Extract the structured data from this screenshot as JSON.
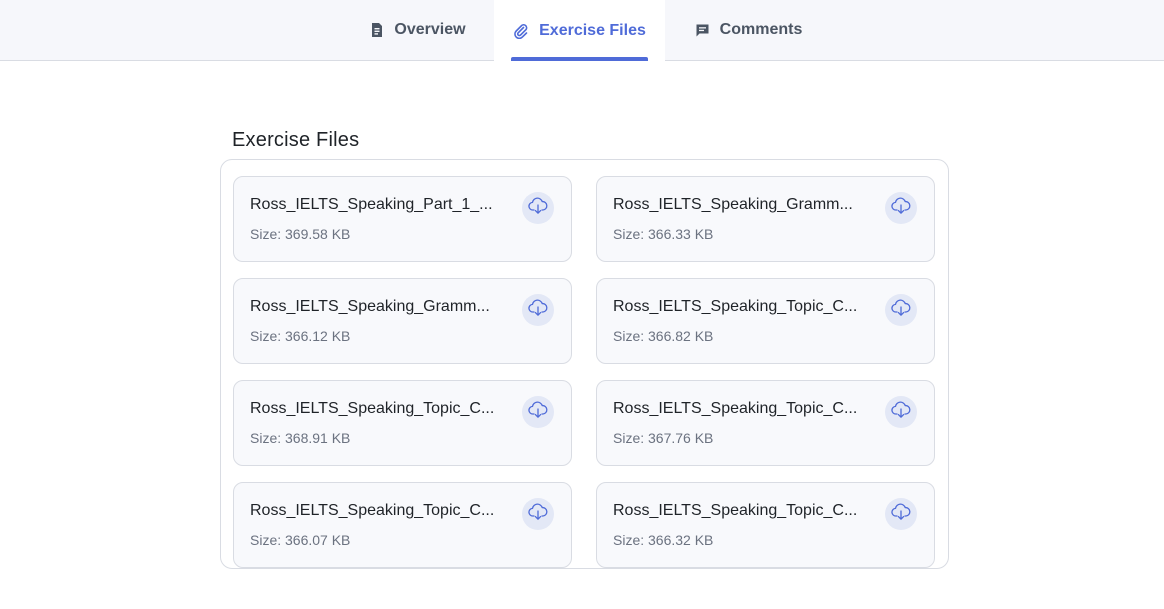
{
  "tabs": [
    {
      "label": "Overview",
      "icon": "document-icon",
      "active": false
    },
    {
      "label": "Exercise Files",
      "icon": "paperclip-icon",
      "active": true
    },
    {
      "label": "Comments",
      "icon": "comment-icon",
      "active": false
    }
  ],
  "section": {
    "title": "Exercise Files"
  },
  "files": [
    {
      "name": "Ross_IELTS_Speaking_Part_1_...",
      "size": "Size: 369.58 KB"
    },
    {
      "name": "Ross_IELTS_Speaking_Gramm...",
      "size": "Size: 366.33 KB"
    },
    {
      "name": "Ross_IELTS_Speaking_Gramm...",
      "size": "Size: 366.12 KB"
    },
    {
      "name": "Ross_IELTS_Speaking_Topic_C...",
      "size": "Size: 366.82 KB"
    },
    {
      "name": "Ross_IELTS_Speaking_Topic_C...",
      "size": "Size: 368.91 KB"
    },
    {
      "name": "Ross_IELTS_Speaking_Topic_C...",
      "size": "Size: 367.76 KB"
    },
    {
      "name": "Ross_IELTS_Speaking_Topic_C...",
      "size": "Size: 366.07 KB"
    },
    {
      "name": "Ross_IELTS_Speaking_Topic_C...",
      "size": "Size: 366.32 KB"
    }
  ],
  "download_icon": "cloud-download-icon",
  "colors": {
    "accent": "#4f6bd8",
    "tab_bar_bg": "#f6f7fb",
    "card_bg": "#f8f9fc",
    "border": "#d9dce3",
    "icon_bg": "#e3e8f6"
  }
}
